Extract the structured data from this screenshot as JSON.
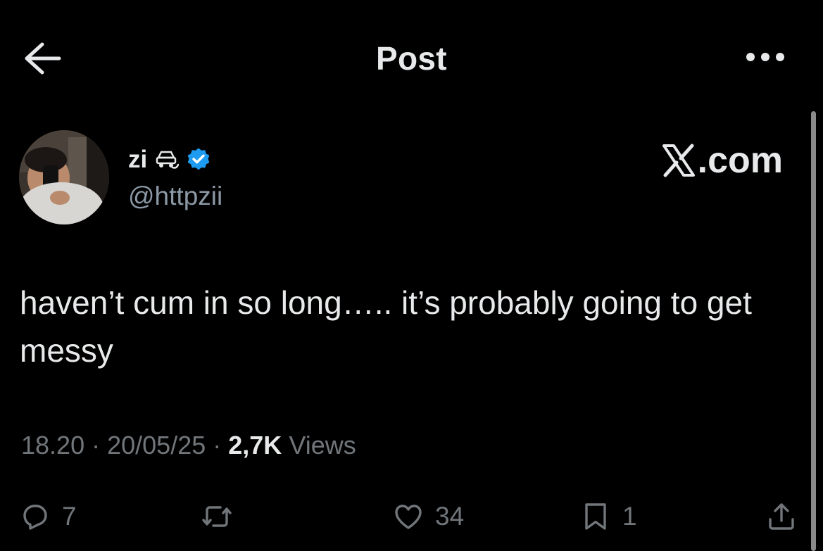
{
  "header": {
    "title": "Post"
  },
  "author": {
    "display_name": "zi",
    "handle": "@httpzii",
    "verified": true,
    "name_emoji": "car-crash-icon"
  },
  "watermark": {
    "text": ".com"
  },
  "tweet": {
    "text": "haven’t cum in so long….. it’s probably going to get messy"
  },
  "meta": {
    "time": "18.20",
    "separator": "·",
    "date": "20/05/25",
    "views_count": "2,7K",
    "views_label": "Views"
  },
  "actions": {
    "reply_count": "7",
    "repost_count": "",
    "like_count": "34",
    "bookmark_count": "1"
  },
  "colors": {
    "background": "#000000",
    "text_primary": "#e7e9ea",
    "text_secondary": "#71767b",
    "verified_blue": "#1d9bf0"
  }
}
